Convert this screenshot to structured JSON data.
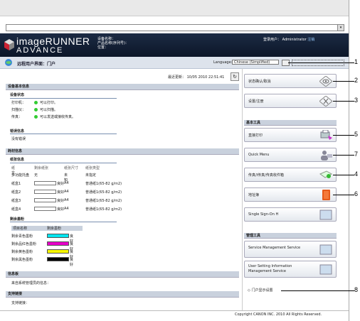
{
  "header": {
    "brand_line1": "imageRUNNER",
    "brand_line2": "ADVANCE",
    "device_name_label": "设备名称：",
    "product_name_label": "产品名称(序列号)：",
    "location_label": "位置：",
    "login_user_label": "登录用户：",
    "login_user_value": "Administrator",
    "logout_link": "注销"
  },
  "portal": {
    "title": "远程用户界面：门户",
    "language_label": "Language:",
    "language_value": "Chinese (Simplified)",
    "last_updated": "最近更新： 10/05 2010 22:51:41"
  },
  "device_basic": {
    "title": "设备基本信息",
    "status_title": "设备状态",
    "status_rows": [
      {
        "label": "打印机：",
        "value": "可以打印。"
      },
      {
        "label": "扫描仪：",
        "value": "可以扫描。"
      },
      {
        "label": "传真：",
        "value": "可以发送或接收传真。"
      }
    ],
    "error_title": "错误信息",
    "error_value": "没有错误"
  },
  "consumables": {
    "title": "耗材信息",
    "paper_title": "纸张信息",
    "paper_headers": [
      "纸盒",
      "剩余纸张",
      "纸张尺寸",
      "纸张类型"
    ],
    "paper_rows": [
      {
        "tray": "多功能托盘",
        "remain": "无",
        "size": "未知",
        "type": "未指定"
      },
      {
        "tray": "纸盒1",
        "remain": "良好",
        "size": "A4",
        "type": "普通纸1(65-82 g/m2)"
      },
      {
        "tray": "纸盒2",
        "remain": "良好",
        "size": "A4",
        "type": "普通纸1(65-82 g/m2)"
      },
      {
        "tray": "纸盒3",
        "remain": "良好",
        "size": "A4",
        "type": "普通纸1(65-82 g/m2)"
      },
      {
        "tray": "纸盒4",
        "remain": "良好",
        "size": "A4",
        "type": "普通纸1(65-82 g/m2)"
      }
    ],
    "toner_title": "剩余墨粉",
    "toner_headers": [
      "项目名称",
      "剩余墨粉"
    ],
    "toner_rows": [
      {
        "name": "剩余青色墨粉",
        "value": "良好",
        "color": "#00e5f0"
      },
      {
        "name": "剩余品红色墨粉",
        "value": "良好",
        "color": "#e600c8"
      },
      {
        "name": "剩余黄色墨粉",
        "value": "良好",
        "color": "#f5f500"
      },
      {
        "name": "剩余黑色墨粉",
        "value": "良好",
        "color": "#000000"
      }
    ]
  },
  "message_board": {
    "title": "信息板",
    "text": "来自系统管理员的信息："
  },
  "support": {
    "title": "支持链接",
    "text": "支持链接："
  },
  "right_panel": {
    "status_monitor": "状态确认/取消",
    "settings": "设置/注册",
    "basic_tools_title": "基本工具",
    "direct_print": "直接打印",
    "quick_menu": "Quick Menu",
    "fax_addr": "传真/I传真/传真收件箱",
    "address_book": "地址簿",
    "sso": "Single Sign-On H",
    "mgmt_tools_title": "管理工具",
    "service_mgmt": "Service Management Service",
    "user_setting_1": "User Setting Information",
    "user_setting_2": "Management Service",
    "portal_display": "门户显示设置"
  },
  "footer": "Copyright CANON INC. 2010 All Rights Reserved.",
  "callouts": [
    "1",
    "2",
    "3",
    "4",
    "5",
    "6",
    "7",
    "8"
  ]
}
